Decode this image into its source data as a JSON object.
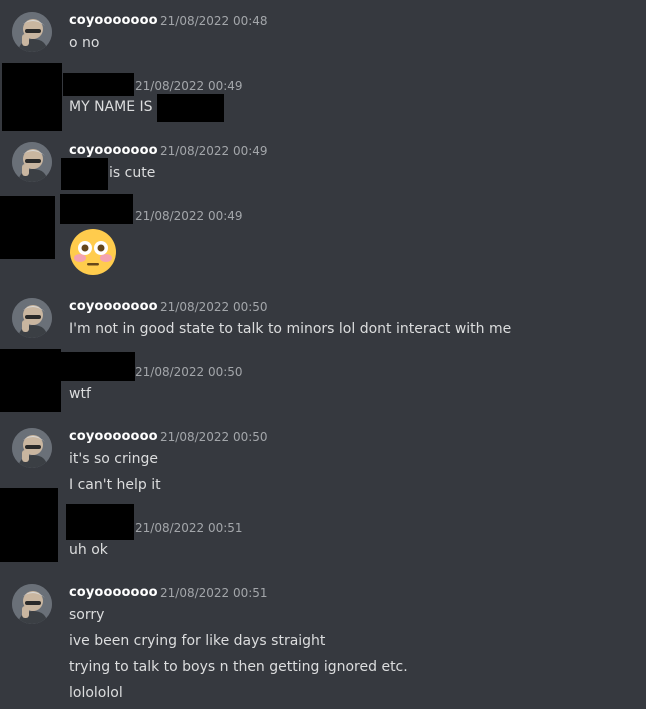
{
  "user": {
    "name": "coyooooooo"
  },
  "groups": [
    {
      "time": "21/08/2022 00:48",
      "lines": [
        "o no"
      ]
    },
    {
      "time": "21/08/2022 00:49",
      "lines": [
        "MY NAME IS"
      ]
    },
    {
      "time": "21/08/2022 00:49",
      "lines": [
        "is cute"
      ]
    },
    {
      "time": "21/08/2022 00:49",
      "emoji": "flushed-face"
    },
    {
      "time": "21/08/2022 00:50",
      "lines": [
        "I'm not in good state to talk to minors lol dont interact with me"
      ]
    },
    {
      "time": "21/08/2022 00:50",
      "lines": [
        "wtf"
      ]
    },
    {
      "time": "21/08/2022 00:50",
      "lines": [
        "it's so cringe",
        "I can't help it"
      ]
    },
    {
      "time": "21/08/2022 00:51",
      "lines": [
        "uh ok"
      ]
    },
    {
      "time": "21/08/2022 00:51",
      "lines": [
        "sorry",
        "ive been crying for like days straight",
        "trying to talk to boys n then getting ignored etc.",
        "lolololol"
      ]
    }
  ],
  "colors": {
    "background": "#36393f",
    "username": "#ffffff",
    "timestamp": "#a3a6aa",
    "message": "#dcddde",
    "redaction": "#000000"
  }
}
